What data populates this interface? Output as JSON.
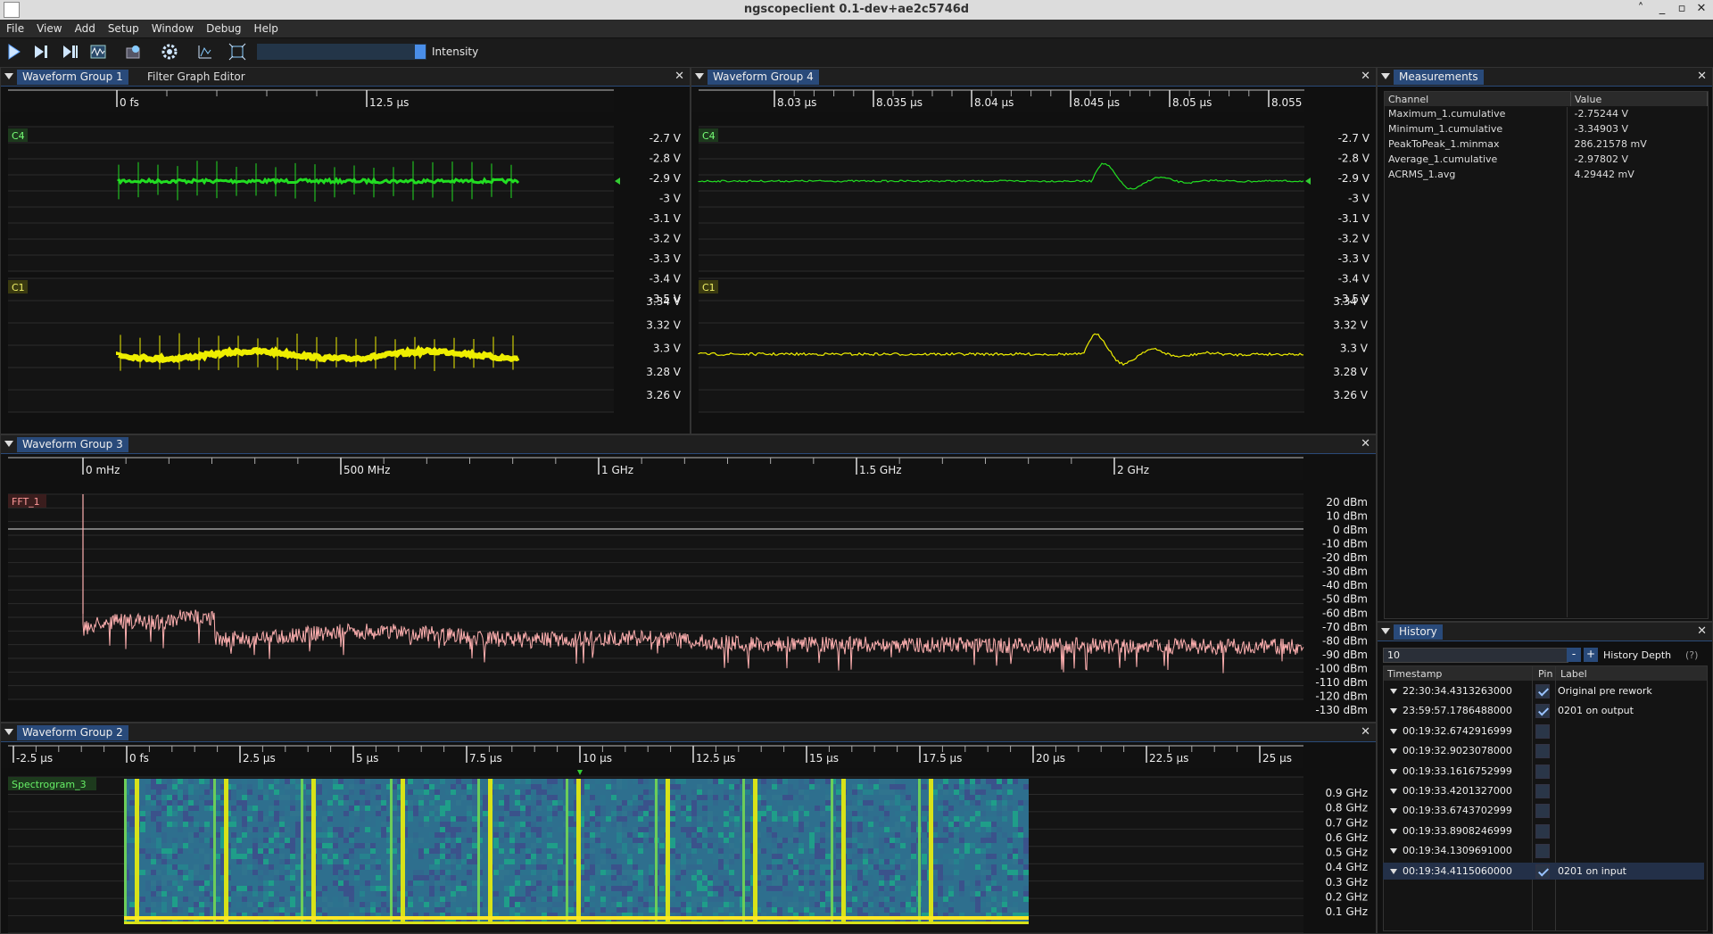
{
  "window": {
    "title": "ngscopeclient 0.1-dev+ae2c5746d"
  },
  "menu": [
    "File",
    "View",
    "Add",
    "Setup",
    "Window",
    "Debug",
    "Help"
  ],
  "toolbar": {
    "intensity_label": "Intensity",
    "intensity_level": 0.95
  },
  "groups": {
    "g1": {
      "tab": "Waveform Group 1",
      "tab2": "Filter Graph Editor",
      "xticks": [
        {
          "label": "0 fs",
          "x": 130
        },
        {
          "label": "12.5 µs",
          "x": 410
        }
      ],
      "c4": {
        "name": "C4",
        "color": "#22dd22",
        "yticks": [
          "-2.7 V",
          "-2.8 V",
          "-2.9 V",
          "-3 V",
          "-3.1 V",
          "-3.2 V",
          "-3.3 V",
          "-3.4 V",
          "-3.5 V"
        ]
      },
      "c1": {
        "name": "C1",
        "color": "#eeee00",
        "yticks": [
          "3.34 V",
          "3.32 V",
          "3.3 V",
          "3.28 V",
          "3.26 V"
        ]
      }
    },
    "g4": {
      "tab": "Waveform Group 4",
      "xticks": [
        {
          "label": "8.03 µs",
          "x": 867
        },
        {
          "label": "8.035 µs",
          "x": 978
        },
        {
          "label": "8.04 µs",
          "x": 1088
        },
        {
          "label": "8.045 µs",
          "x": 1199
        },
        {
          "label": "8.05 µs",
          "x": 1310
        },
        {
          "label": "8.055",
          "x": 1421
        }
      ],
      "c4": {
        "name": "C4",
        "yticks": [
          "-2.7 V",
          "-2.8 V",
          "-2.9 V",
          "-3 V",
          "-3.1 V",
          "-3.2 V",
          "-3.3 V",
          "-3.4 V",
          "-3.5 V"
        ]
      },
      "c1": {
        "name": "C1",
        "yticks": [
          "3.34 V",
          "3.32 V",
          "3.3 V",
          "3.28 V",
          "3.26 V"
        ]
      }
    },
    "g3": {
      "tab": "Waveform Group 3",
      "xticks": [
        {
          "label": "0 mHz",
          "x": 92
        },
        {
          "label": "500 MHz",
          "x": 381
        },
        {
          "label": "1 GHz",
          "x": 670
        },
        {
          "label": "1.5 GHz",
          "x": 959
        },
        {
          "label": "2 GHz",
          "x": 1248
        }
      ],
      "fft": {
        "name": "FFT_1",
        "color": "#ffb0b0",
        "yticks": [
          "20 dBm",
          "10 dBm",
          "0 dBm",
          "-10 dBm",
          "-20 dBm",
          "-30 dBm",
          "-40 dBm",
          "-50 dBm",
          "-60 dBm",
          "-70 dBm",
          "-80 dBm",
          "-90 dBm",
          "-100 dBm",
          "-110 dBm",
          "-120 dBm",
          "-130 dBm"
        ]
      }
    },
    "g2": {
      "tab": "Waveform Group 2",
      "xticks": [
        {
          "label": "-2.5 µs",
          "x": 14
        },
        {
          "label": "0 fs",
          "x": 141
        },
        {
          "label": "2.5 µs",
          "x": 268
        },
        {
          "label": "5 µs",
          "x": 395
        },
        {
          "label": "7.5 µs",
          "x": 522
        },
        {
          "label": "10 µs",
          "x": 649
        },
        {
          "label": "12.5 µs",
          "x": 776
        },
        {
          "label": "15 µs",
          "x": 903
        },
        {
          "label": "17.5 µs",
          "x": 1030
        },
        {
          "label": "20 µs",
          "x": 1157
        },
        {
          "label": "22.5 µs",
          "x": 1284
        },
        {
          "label": "25 µs",
          "x": 1411
        }
      ],
      "spec": {
        "name": "Spectrogram_3",
        "yticks": [
          "0.9 GHz",
          "0.8 GHz",
          "0.7 GHz",
          "0.6 GHz",
          "0.5 GHz",
          "0.4 GHz",
          "0.3 GHz",
          "0.2 GHz",
          "0.1 GHz"
        ]
      }
    }
  },
  "measurements": {
    "tab": "Measurements",
    "headers": [
      "Channel",
      "Value"
    ],
    "rows": [
      {
        "channel": "Maximum_1.cumulative",
        "value": "-2.75244 V"
      },
      {
        "channel": "Minimum_1.cumulative",
        "value": "-3.34903 V"
      },
      {
        "channel": "PeakToPeak_1.minmax",
        "value": "286.21578 mV"
      },
      {
        "channel": "Average_1.cumulative",
        "value": "-2.97802 V"
      },
      {
        "channel": "ACRMS_1.avg",
        "value": "4.29442 mV"
      }
    ]
  },
  "history": {
    "tab": "History",
    "depth_value": "10",
    "minus": "-",
    "plus": "+",
    "depth_label": "History Depth",
    "help": "(?)",
    "headers": [
      "Timestamp",
      "Pin",
      "Label"
    ],
    "rows": [
      {
        "ts": "22:30:34.4313263000",
        "pinned": true,
        "label": "Original pre rework"
      },
      {
        "ts": "23:59:57.1786488000",
        "pinned": true,
        "label": "0201 on output"
      },
      {
        "ts": "00:19:32.6742916999",
        "pinned": false,
        "label": ""
      },
      {
        "ts": "00:19:32.9023078000",
        "pinned": false,
        "label": ""
      },
      {
        "ts": "00:19:33.1616752999",
        "pinned": false,
        "label": ""
      },
      {
        "ts": "00:19:33.4201327000",
        "pinned": false,
        "label": ""
      },
      {
        "ts": "00:19:33.6743702999",
        "pinned": false,
        "label": ""
      },
      {
        "ts": "00:19:33.8908246999",
        "pinned": false,
        "label": ""
      },
      {
        "ts": "00:19:34.1309691000",
        "pinned": false,
        "label": ""
      },
      {
        "ts": "00:19:34.4115060000",
        "pinned": true,
        "label": "0201 on input"
      }
    ]
  }
}
